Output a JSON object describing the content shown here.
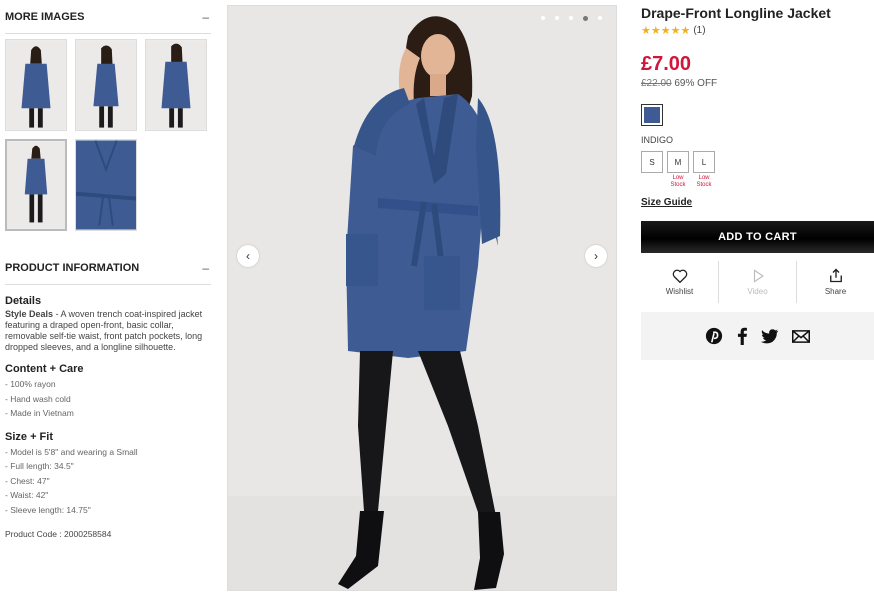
{
  "left": {
    "more_images_heading": "MORE IMAGES",
    "more_images_toggle": "–",
    "thumbnails": 5,
    "product_info_heading": "PRODUCT INFORMATION",
    "product_info_toggle": "–",
    "details_title": "Details",
    "details_lead": "Style Deals",
    "details_text": " - A woven trench coat-inspired jacket featuring a draped open-front, basic collar, removable self-tie waist, front patch pockets, long dropped sleeves, and a longline silhouette.",
    "content_title": "Content + Care",
    "content_items": [
      "- 100% rayon",
      "- Hand wash cold",
      "- Made in Vietnam"
    ],
    "size_title": "Size + Fit",
    "size_items": [
      "- Model is 5'8\" and wearing a Small",
      "- Full length: 34.5\"",
      "- Chest: 47\"",
      "- Waist: 42\"",
      "- Sleeve length: 14.75\""
    ],
    "product_code": "Product Code : 2000258584"
  },
  "gallery": {
    "prev_icon": "‹",
    "next_icon": "›",
    "dot_count": 5,
    "active_dot": 3
  },
  "product": {
    "title": "Drape-Front Longline Jacket",
    "stars": "★★★★★",
    "review_count": "(1)",
    "price": "£7.00",
    "old_price": "£22.00",
    "discount": " 69% OFF",
    "swatch_color": "#3e5c93",
    "color_name": "INDIGO",
    "sizes": [
      {
        "label": "S",
        "low": ""
      },
      {
        "label": "M",
        "low": "Low Stock"
      },
      {
        "label": "L",
        "low": "Low Stock"
      }
    ],
    "size_guide": "Size Guide",
    "add_to_cart": "ADD TO CART",
    "wishlist_label": "Wishlist",
    "video_label": "Video",
    "share_label": "Share"
  },
  "colors": {
    "price": "#d2153b",
    "stars": "#f2b01e",
    "garment": "#3e5c93"
  }
}
